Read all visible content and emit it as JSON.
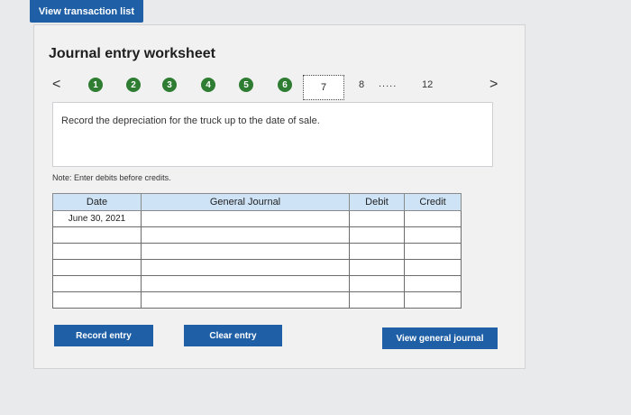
{
  "top": {
    "view_transaction_list": "View transaction list"
  },
  "worksheet": {
    "title": "Journal entry worksheet",
    "steps": [
      "1",
      "2",
      "3",
      "4",
      "5",
      "6"
    ],
    "current_step": "7",
    "next_step": "8",
    "ellipsis": ".....",
    "last_step": "12",
    "prev_arrow": "<",
    "next_arrow": ">",
    "instruction": "Record the depreciation for the truck up to the date of sale.",
    "note": "Note: Enter debits before credits."
  },
  "table": {
    "headers": {
      "date": "Date",
      "general_journal": "General Journal",
      "debit": "Debit",
      "credit": "Credit"
    },
    "rows": [
      {
        "date": "June 30, 2021"
      },
      {
        "date": ""
      },
      {
        "date": ""
      },
      {
        "date": ""
      },
      {
        "date": ""
      },
      {
        "date": ""
      }
    ]
  },
  "buttons": {
    "record_entry": "Record entry",
    "clear_entry": "Clear entry",
    "view_general_journal": "View general journal"
  },
  "colors": {
    "button_blue": "#1f5fa6",
    "step_green": "#2f7d32",
    "header_blue": "#cfe3f7"
  }
}
